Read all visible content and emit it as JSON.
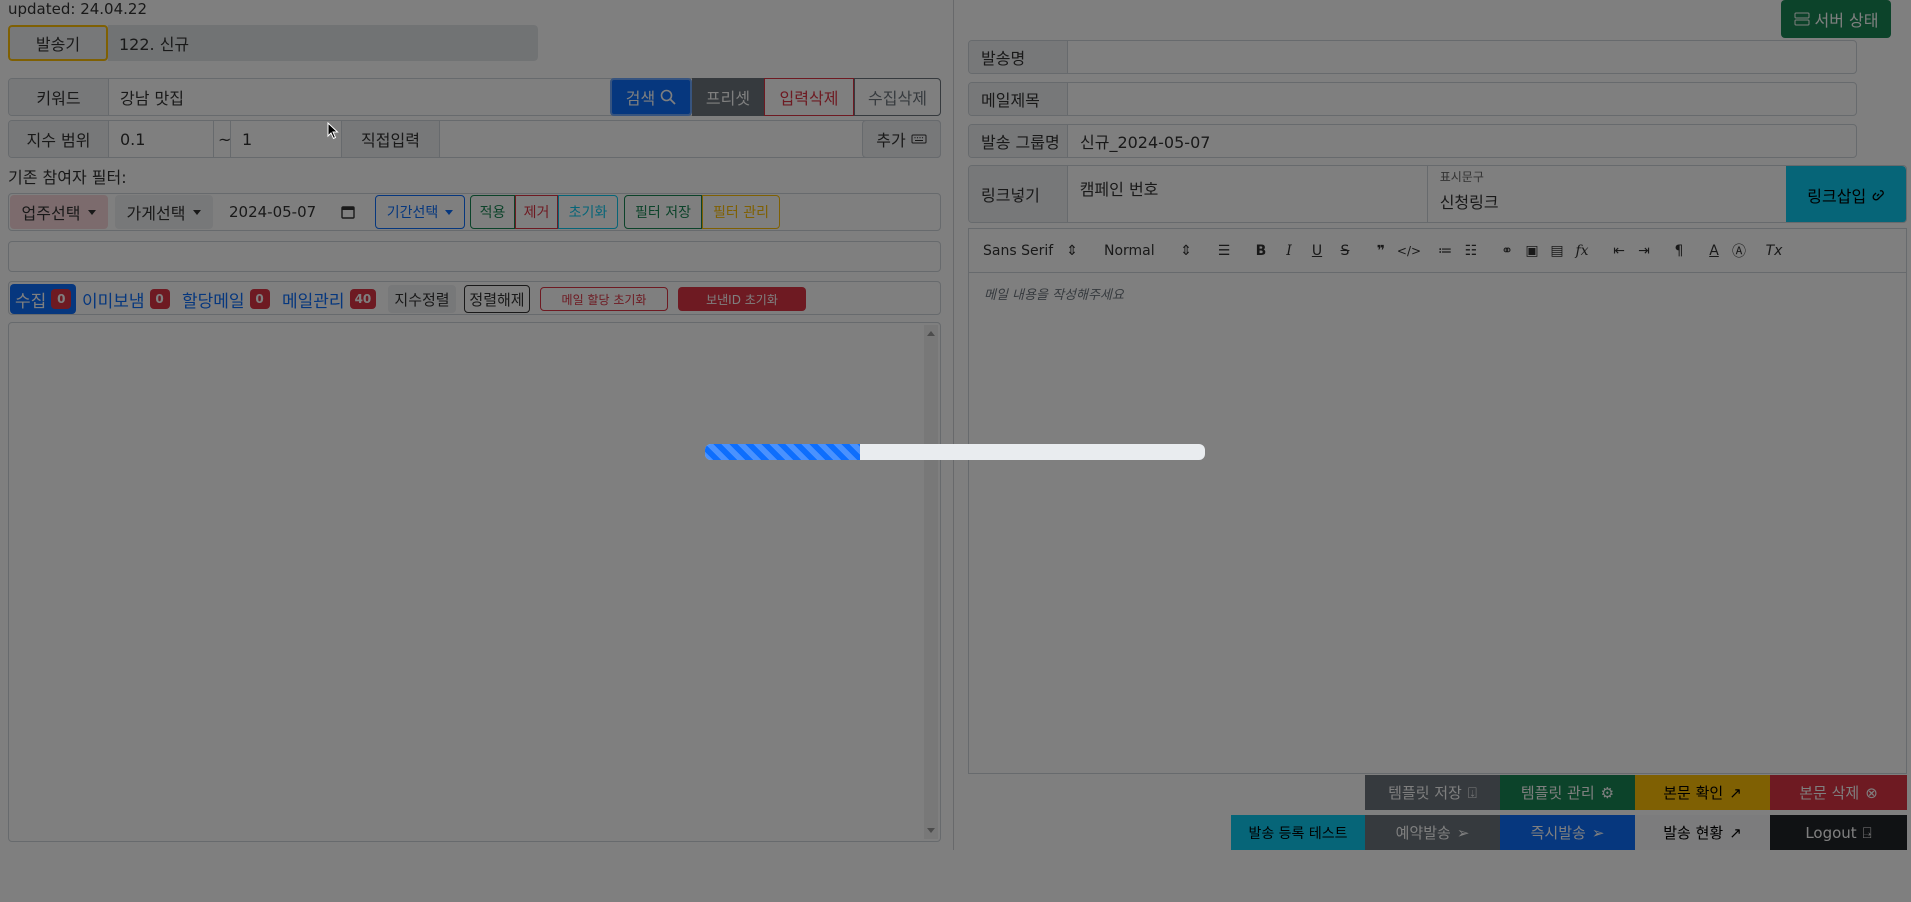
{
  "updated": "updated: 24.04.22",
  "sender": {
    "label": "발송기",
    "value": "122. 신규"
  },
  "keyword": {
    "label": "키워드",
    "value": "강남 맛집"
  },
  "search_buttons": {
    "search": "검색",
    "preset": "프리셋",
    "clear_input": "입력삭제",
    "clear_collect": "수집삭제"
  },
  "index_range": {
    "label": "지수 범위",
    "min": "0.1",
    "sep": "~",
    "max": "1",
    "direct": "직접입력",
    "add": "추가"
  },
  "filter_title": "기존 참여자 필터:",
  "filters": {
    "business": "업주선택",
    "store": "가게선택",
    "date": "2024-05-07",
    "period": "기간선택",
    "apply": "적용",
    "remove": "제거",
    "reset": "초기화",
    "save": "필터 저장",
    "manage": "필터 관리"
  },
  "tabs": [
    {
      "label": "수집",
      "count": "0"
    },
    {
      "label": "이미보냄",
      "count": "0"
    },
    {
      "label": "할당메일",
      "count": "0"
    },
    {
      "label": "메일관리",
      "count": "40"
    }
  ],
  "tab_buttons": {
    "sort": "지수정렬",
    "unsort": "정렬해제",
    "reset_mail": "메일 할당 초기화",
    "reset_sender": "보낸ID 초기화"
  },
  "right": {
    "server_status": "서버 상태",
    "send_name": "발송명",
    "mail_subject": "메일제목",
    "group_label": "발송 그룹명",
    "group_value": "신규_2024-05-07",
    "link_label": "링크넣기",
    "campaign": "캠페인 번호",
    "display_caption": "표시문구",
    "display_value": "신청링크",
    "link_insert": "링크삽입",
    "font": "Sans Serif",
    "size": "Normal",
    "placeholder": "메일 내용을 작성해주세요"
  },
  "actions": {
    "tpl_save": "템플릿 저장",
    "tpl_manage": "템플릿 관리",
    "body_check": "본문 확인",
    "body_delete": "본문 삭제",
    "test_send": "발송 등록 테스트",
    "reserve": "예약발송",
    "instant": "즉시발송",
    "status": "발송 현황",
    "logout": "Logout"
  },
  "progress": {
    "fraction": 0.31
  },
  "colors": {
    "primary": "#0d6efd",
    "danger": "#dc3545",
    "success": "#198754",
    "info": "#0dcaf0",
    "warning": "#ffc107",
    "secondary": "#6c757d"
  }
}
